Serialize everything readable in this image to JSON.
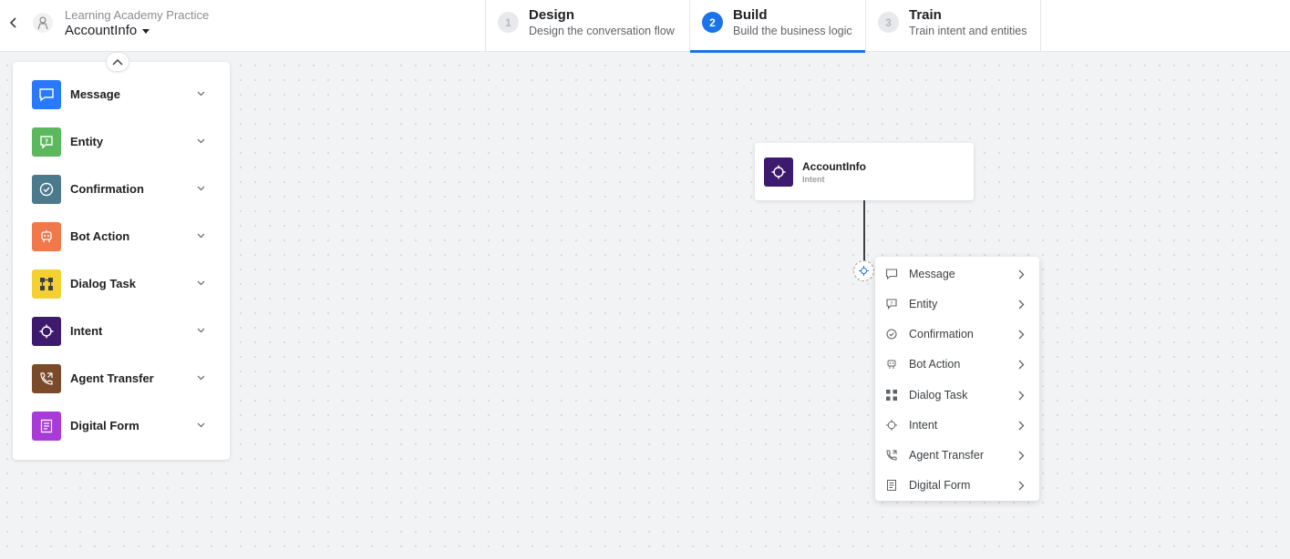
{
  "header": {
    "app_name": "Learning Academy Practice",
    "dialog_name": "AccountInfo",
    "steps": [
      {
        "num": "1",
        "title": "Design",
        "desc": "Design the conversation flow"
      },
      {
        "num": "2",
        "title": "Build",
        "desc": "Build the business logic"
      },
      {
        "num": "3",
        "title": "Train",
        "desc": "Train intent and entities"
      }
    ],
    "active_step": "Build"
  },
  "palette": {
    "items": [
      {
        "label": "Message",
        "icon": "message-icon",
        "color": "#2979ff"
      },
      {
        "label": "Entity",
        "icon": "entity-icon",
        "color": "#5cb85c"
      },
      {
        "label": "Confirmation",
        "icon": "confirmation-icon",
        "color": "#4a7a8c"
      },
      {
        "label": "Bot Action",
        "icon": "bot-action-icon",
        "color": "#f0784a"
      },
      {
        "label": "Dialog Task",
        "icon": "dialog-task-icon",
        "color": "#f5d033"
      },
      {
        "label": "Intent",
        "icon": "intent-icon",
        "color": "#3d1a6e"
      },
      {
        "label": "Agent Transfer",
        "icon": "agent-transfer-icon",
        "color": "#7a4a2a"
      },
      {
        "label": "Digital Form",
        "icon": "digital-form-icon",
        "color": "#a83ad8"
      }
    ]
  },
  "canvas": {
    "node": {
      "title": "AccountInfo",
      "subtitle": "Intent",
      "icon": "intent-icon",
      "color": "#3d1a6e"
    }
  },
  "menu": {
    "items": [
      {
        "label": "Message",
        "icon": "message-icon"
      },
      {
        "label": "Entity",
        "icon": "entity-icon"
      },
      {
        "label": "Confirmation",
        "icon": "confirmation-icon"
      },
      {
        "label": "Bot Action",
        "icon": "bot-action-icon"
      },
      {
        "label": "Dialog Task",
        "icon": "dialog-task-icon"
      },
      {
        "label": "Intent",
        "icon": "intent-icon"
      },
      {
        "label": "Agent Transfer",
        "icon": "agent-transfer-icon"
      },
      {
        "label": "Digital Form",
        "icon": "digital-form-icon"
      }
    ]
  },
  "colors": {
    "accent": "#1a73e8"
  }
}
